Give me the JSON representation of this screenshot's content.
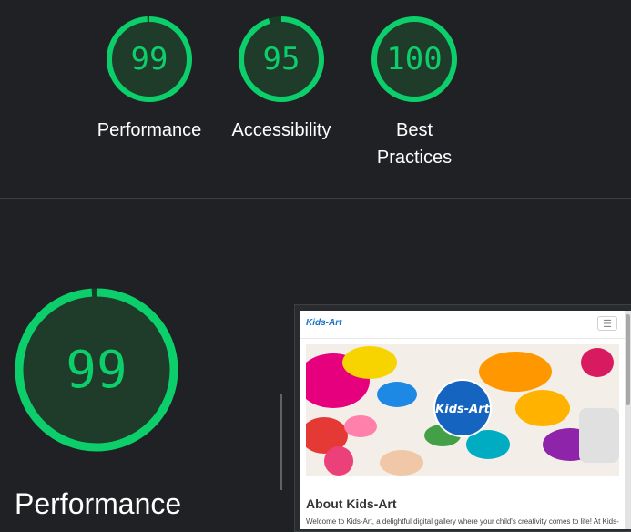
{
  "colors": {
    "pass": "#0cce6b",
    "pass_fill": "#1f3b2a",
    "track": "#163d26",
    "background": "#202124"
  },
  "summary": [
    {
      "id": "performance",
      "score": "99",
      "label_lines": [
        "Performance"
      ],
      "fraction": 0.99
    },
    {
      "id": "accessibility",
      "score": "95",
      "label_lines": [
        "Accessibility"
      ],
      "fraction": 0.95
    },
    {
      "id": "best-practices",
      "score": "100",
      "label_lines": [
        "Best",
        "Practices"
      ],
      "fraction": 1.0
    }
  ],
  "detail": {
    "score": "99",
    "fraction": 0.99,
    "title": "Performance"
  },
  "screenshot": {
    "brand": "Kids-Art",
    "logo_text": "Kids-Art",
    "menu_icon": "hamburger-icon",
    "heading": "About Kids-Art",
    "paragraph": "Welcome to Kids-Art, a delightful digital gallery where your child's creativity comes to life! At Kids-"
  }
}
